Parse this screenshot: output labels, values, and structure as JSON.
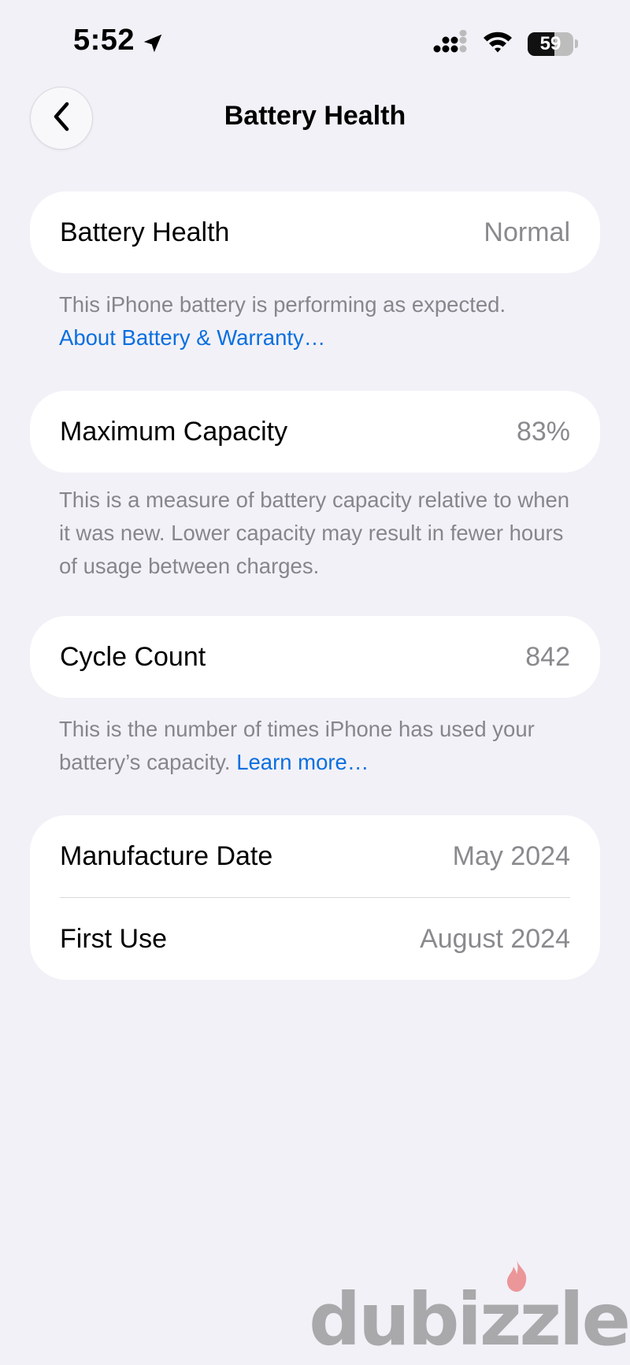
{
  "status_bar": {
    "time": "5:52",
    "battery_level": "59",
    "battery_fraction": 0.59
  },
  "nav": {
    "title": "Battery Health"
  },
  "health_section": {
    "label": "Battery Health",
    "value": "Normal",
    "footnote": "This iPhone battery is performing as expected.",
    "link": "About Battery & Warranty…"
  },
  "capacity_section": {
    "label": "Maximum Capacity",
    "value": "83%",
    "footnote": "This is a measure of battery capacity relative to when it was new. Lower capacity may result in fewer hours of usage between charges."
  },
  "cycle_section": {
    "label": "Cycle Count",
    "value": "842",
    "footnote": "This is the number of times iPhone has used your battery’s capacity.",
    "link": "Learn more…"
  },
  "dates_section": {
    "manufacture_label": "Manufacture Date",
    "manufacture_value": "May 2024",
    "first_use_label": "First Use",
    "first_use_value": "August 2024"
  },
  "watermark": {
    "text": "dubizzle"
  },
  "colors": {
    "background": "#f2f1f7",
    "link": "#0a6fe0",
    "secondary_text": "#86868b"
  },
  "icons": [
    "location-arrow-icon",
    "signal-icon",
    "wifi-icon",
    "battery-icon",
    "chevron-left-icon"
  ]
}
